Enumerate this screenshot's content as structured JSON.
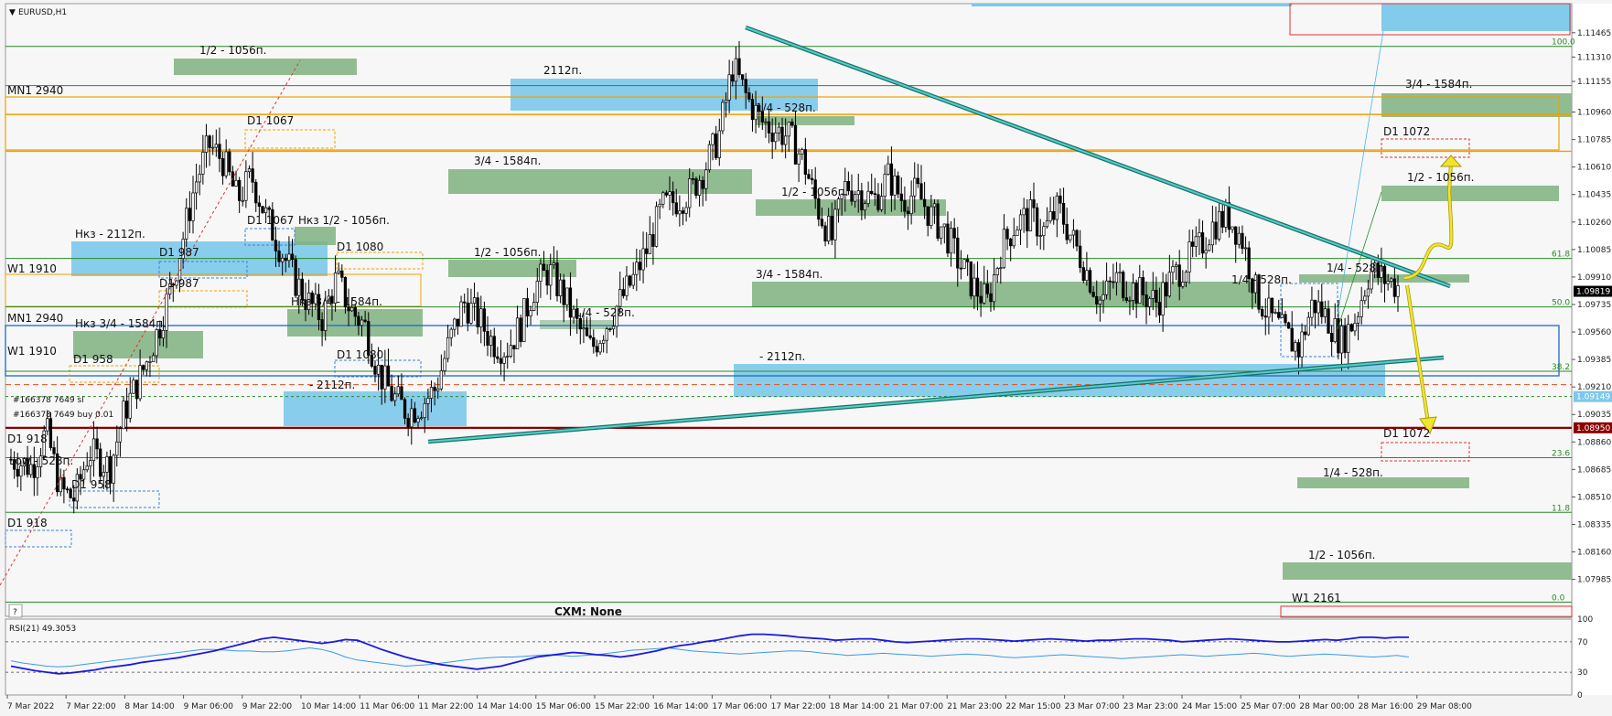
{
  "window": {
    "symbol_title": "EURUSD,H1",
    "footer_label": "CXM: None",
    "help_marker": "?"
  },
  "colors": {
    "bull": "#000000",
    "bear": "#000000",
    "green_zone": "#7fb27f",
    "blue_zone": "#7cc8ea",
    "trend_line": "#2a9d9a",
    "arrow": "#f2e42a",
    "orange": "#f0a000",
    "red": "#8b0000",
    "rsi_main": "#1a1adb",
    "rsi_second": "#3a9ae8"
  },
  "chart_data": {
    "type": "candlestick",
    "price_scale": {
      "min": 1.0775,
      "max": 1.1165,
      "ticks": [
        "1.11465",
        "1.11310",
        "1.11155",
        "1.10960",
        "1.10785",
        "1.10610",
        "1.10435",
        "1.10260",
        "1.10085",
        "1.09910",
        "1.09735",
        "1.09560",
        "1.09385",
        "1.09210",
        "1.09035",
        "1.08860",
        "1.08685",
        "1.08510",
        "1.08335",
        "1.08160",
        "1.07985"
      ],
      "tick_values": [
        1.11465,
        1.1131,
        1.11155,
        1.1096,
        1.10785,
        1.1061,
        1.10435,
        1.1026,
        1.10085,
        1.0991,
        1.09735,
        1.0956,
        1.09385,
        1.0921,
        1.09035,
        1.0886,
        1.08685,
        1.0851,
        1.08335,
        1.0816,
        1.07985
      ]
    },
    "price_tags": [
      {
        "text": "1.09819",
        "value": 1.09819,
        "bg": "#000000",
        "fg": "#ffffff"
      },
      {
        "text": "1.09149",
        "value": 1.09149,
        "bg": "#7cc8ea",
        "fg": "#ffffff"
      },
      {
        "text": "1.08950",
        "value": 1.0895,
        "bg": "#8b0000",
        "fg": "#ffffff"
      }
    ],
    "time_labels": [
      "7 Mar 2022",
      "7 Mar 22:00",
      "8 Mar 14:00",
      "9 Mar 06:00",
      "9 Mar 22:00",
      "10 Mar 14:00",
      "11 Mar 06:00",
      "11 Mar 22:00",
      "14 Mar 14:00",
      "15 Mar 06:00",
      "15 Mar 22:00",
      "16 Mar 14:00",
      "17 Mar 06:00",
      "17 Mar 22:00",
      "18 Mar 14:00",
      "21 Mar 07:00",
      "21 Mar 23:00",
      "22 Mar 15:00",
      "23 Mar 07:00",
      "23 Mar 23:00",
      "24 Mar 15:00",
      "25 Mar 07:00",
      "28 Mar 00:00",
      "28 Mar 16:00",
      "29 Mar 08:00"
    ],
    "price_path": [
      [
        0,
        1.0875
      ],
      [
        3,
        1.087
      ],
      [
        5,
        1.0893
      ],
      [
        7,
        1.0855
      ],
      [
        9,
        1.085
      ],
      [
        11,
        1.088
      ],
      [
        14,
        1.087
      ],
      [
        16,
        1.0905
      ],
      [
        19,
        1.0935
      ],
      [
        21,
        1.096
      ],
      [
        23,
        1.099
      ],
      [
        26,
        1.105
      ],
      [
        28,
        1.1075
      ],
      [
        30,
        1.1065
      ],
      [
        32,
        1.104
      ],
      [
        34,
        1.1055
      ],
      [
        36,
        1.103
      ],
      [
        38,
        1.101
      ],
      [
        40,
        1.099
      ],
      [
        42,
        1.0975
      ],
      [
        44,
        1.0965
      ],
      [
        46,
        1.099
      ],
      [
        48,
        1.097
      ],
      [
        50,
        1.096
      ],
      [
        52,
        1.093
      ],
      [
        54,
        1.0915
      ],
      [
        56,
        1.0905
      ],
      [
        58,
        1.091
      ],
      [
        60,
        1.092
      ],
      [
        62,
        1.095
      ],
      [
        64,
        1.0975
      ],
      [
        66,
        1.0965
      ],
      [
        68,
        1.095
      ],
      [
        70,
        1.0945
      ],
      [
        72,
        1.096
      ],
      [
        74,
        1.0985
      ],
      [
        76,
        1.0995
      ],
      [
        78,
        1.098
      ],
      [
        80,
        1.096
      ],
      [
        82,
        1.0945
      ],
      [
        84,
        1.096
      ],
      [
        86,
        1.0975
      ],
      [
        88,
        1.099
      ],
      [
        90,
        1.101
      ],
      [
        92,
        1.1035
      ],
      [
        94,
        1.104
      ],
      [
        96,
        1.1045
      ],
      [
        98,
        1.106
      ],
      [
        100,
        1.108
      ],
      [
        102,
        1.1125
      ],
      [
        104,
        1.1105
      ],
      [
        106,
        1.109
      ],
      [
        108,
        1.1085
      ],
      [
        110,
        1.108
      ],
      [
        112,
        1.1065
      ],
      [
        114,
        1.1035
      ],
      [
        116,
        1.1015
      ],
      [
        118,
        1.105
      ],
      [
        120,
        1.1045
      ],
      [
        122,
        1.104
      ],
      [
        124,
        1.1055
      ],
      [
        126,
        1.104
      ],
      [
        128,
        1.1045
      ],
      [
        130,
        1.103
      ],
      [
        132,
        1.102
      ],
      [
        134,
        1.1
      ],
      [
        136,
        1.0985
      ],
      [
        138,
        1.0975
      ],
      [
        140,
        1.101
      ],
      [
        142,
        1.1025
      ],
      [
        144,
        1.103
      ],
      [
        146,
        1.102
      ],
      [
        148,
        1.1035
      ],
      [
        150,
        1.1015
      ],
      [
        152,
        1.0995
      ],
      [
        154,
        1.0975
      ],
      [
        156,
        1.099
      ],
      [
        158,
        1.0985
      ],
      [
        160,
        1.098
      ],
      [
        162,
        1.0975
      ],
      [
        164,
        1.099
      ],
      [
        166,
        1.1
      ],
      [
        168,
        1.101
      ],
      [
        170,
        1.1025
      ],
      [
        172,
        1.103
      ],
      [
        174,
        1.1015
      ],
      [
        176,
        1.098
      ],
      [
        178,
        1.0965
      ],
      [
        180,
        1.0955
      ],
      [
        182,
        1.0945
      ],
      [
        184,
        1.0975
      ],
      [
        186,
        1.0965
      ],
      [
        188,
        1.095
      ],
      [
        190,
        1.0965
      ],
      [
        192,
        1.0995
      ],
      [
        194,
        1.099
      ],
      [
        196,
        1.0985
      ]
    ],
    "levels": [
      {
        "value": 1.11378,
        "color": "#2a8a2a",
        "width": 1,
        "fib": "100.0"
      },
      {
        "value": 1.11128,
        "color": "#2a8a2a",
        "width": 1,
        "from": 0,
        "to": 1530
      },
      {
        "value": 1.10945,
        "color": "#f0a000",
        "width": 1.4,
        "label": "MN1 2940"
      },
      {
        "value": 1.1071,
        "color": "#f0a000",
        "width": 1.4
      },
      {
        "value": 1.10028,
        "color": "#2a8a2a",
        "width": 1,
        "label": "W1 1910",
        "fib": "61.8"
      },
      {
        "value": 1.0972,
        "color": "#2a8a2a",
        "width": 1,
        "fib": "50.0"
      },
      {
        "value": 1.0931,
        "color": "#2a8a2a",
        "width": 1,
        "fib": "38.2"
      },
      {
        "value": 1.09225,
        "color": "#e05020",
        "width": 1,
        "dash": "6,4"
      },
      {
        "value": 1.09149,
        "color": "#2a8a2a",
        "width": 1,
        "dash": "3,3"
      },
      {
        "value": 1.0895,
        "color": "#8b0000",
        "width": 2.2
      },
      {
        "value": 1.0876,
        "color": "#2a8a2a",
        "width": 1,
        "fib": "23.6"
      },
      {
        "value": 1.08412,
        "color": "#2a8a2a",
        "width": 1,
        "fib": "11.8"
      },
      {
        "value": 1.0784,
        "color": "#2a8a2a",
        "width": 1,
        "fib": "0.0"
      }
    ],
    "annotations": [
      {
        "text": "1/2 - 1056п."
      },
      {
        "text": "MN1 2940"
      },
      {
        "text": "D1 1067"
      },
      {
        "text": "D1 1067"
      },
      {
        "text": "Нкз 1/2 - 1056п."
      },
      {
        "text": "Нкз - 2112п."
      },
      {
        "text": "D1 987"
      },
      {
        "text": "D1 987"
      },
      {
        "text": "D1 1080"
      },
      {
        "text": "W1 1910"
      },
      {
        "text": "Нкз 3/4 - 1584п."
      },
      {
        "text": "MN1 2940"
      },
      {
        "text": "Нкз 3/4 - 1584п."
      },
      {
        "text": "W1 1910"
      },
      {
        "text": "D1 958"
      },
      {
        "text": "D1 1080"
      },
      {
        "text": "- 2112п."
      },
      {
        "text": "#166378 7649 sl"
      },
      {
        "text": "#166378 7649 buy 0.01"
      },
      {
        "text": "D1 918"
      },
      {
        "text": "Low - 528п."
      },
      {
        "text": "D1 958"
      },
      {
        "text": "D1 918"
      },
      {
        "text": "2112п."
      },
      {
        "text": "3/4 - 1584п."
      },
      {
        "text": "1/2 - 1056п."
      },
      {
        "text": "1/4 - 528п."
      },
      {
        "text": "1/4 - 528п."
      },
      {
        "text": "1/2 - 1056п."
      },
      {
        "text": "3/4 - 1584п."
      },
      {
        "text": "- 2112п."
      },
      {
        "text": "1/4 - 528п."
      },
      {
        "text": "1/4 - 528п."
      },
      {
        "text": "3/4 - 1584п."
      },
      {
        "text": "D1 1072"
      },
      {
        "text": "1/2 - 1056п."
      },
      {
        "text": "D1 1072"
      },
      {
        "text": "1/4 - 528п."
      },
      {
        "text": "1/2 - 1056п."
      },
      {
        "text": "W1 2161"
      }
    ],
    "indicator": {
      "name": "RSI(21) 49.3053",
      "levels": [
        70,
        30
      ],
      "y_ticks": [
        "100",
        "70",
        "30",
        "0"
      ],
      "main_series": [
        38,
        35,
        32,
        30,
        28,
        29,
        31,
        33,
        36,
        38,
        40,
        43,
        45,
        47,
        49,
        52,
        55,
        58,
        62,
        66,
        70,
        74,
        76,
        74,
        72,
        70,
        68,
        70,
        73,
        72,
        66,
        60,
        55,
        50,
        46,
        43,
        40,
        38,
        36,
        34,
        36,
        38,
        42,
        46,
        50,
        52,
        54,
        56,
        55,
        53,
        52,
        50,
        52,
        55,
        58,
        62,
        65,
        67,
        70,
        72,
        75,
        78,
        80,
        80,
        79,
        78,
        76,
        75,
        74,
        72,
        73,
        74,
        74,
        72,
        70,
        69,
        70,
        71,
        72,
        73,
        74,
        74,
        73,
        72,
        71,
        72,
        73,
        74,
        73,
        72,
        71,
        72,
        72,
        73,
        74,
        74,
        73,
        72,
        70,
        71,
        72,
        73,
        74,
        73,
        72,
        71,
        70,
        70,
        71,
        72,
        73,
        72,
        74,
        76,
        76,
        75,
        76,
        76
      ],
      "second_series": [
        45,
        42,
        40,
        38,
        37,
        38,
        40,
        42,
        44,
        46,
        48,
        50,
        52,
        54,
        56,
        58,
        60,
        60,
        59,
        58,
        58,
        57,
        57,
        58,
        60,
        62,
        60,
        56,
        50,
        46,
        44,
        42,
        40,
        38,
        39,
        40,
        42,
        44,
        46,
        48,
        49,
        50,
        50,
        51,
        52,
        53,
        52,
        51,
        52,
        53,
        55,
        57,
        59,
        60,
        61,
        62,
        60,
        58,
        57,
        56,
        55,
        54,
        55,
        56,
        57,
        58,
        58,
        57,
        55,
        54,
        52,
        53,
        54,
        55,
        54,
        53,
        52,
        51,
        52,
        53,
        54,
        53,
        52,
        50,
        49,
        50,
        51,
        52,
        53,
        52,
        51,
        50,
        49,
        48,
        49,
        50,
        51,
        52,
        53,
        52,
        51,
        52,
        53,
        54,
        55,
        54,
        52,
        51,
        52,
        53,
        54,
        53,
        52,
        51,
        50,
        51,
        52,
        50
      ]
    }
  }
}
